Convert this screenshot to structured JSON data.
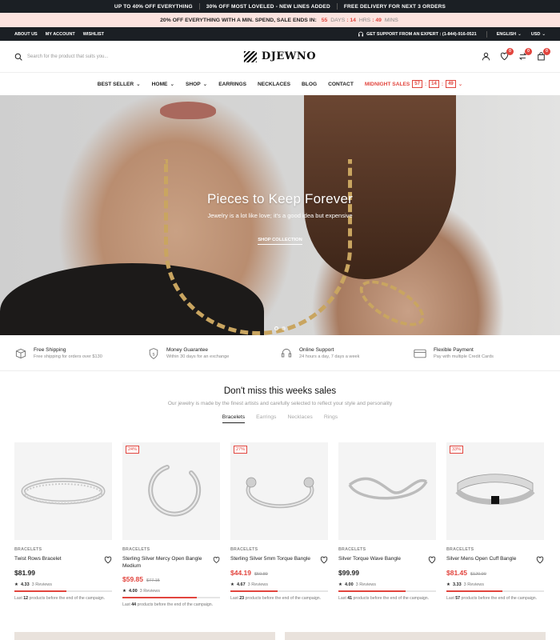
{
  "announcement": [
    "UP TO 40% OFF EVERYTHING",
    "30% OFF MOST LOVELED - NEW LINES ADDED",
    "FREE DELIVERY FOR NEXT 3 ORDERS"
  ],
  "promo": {
    "text": "20% OFF EVERYTHING WITH A MIN. SPEND, SALE ENDS IN:",
    "days": "55",
    "days_label": "DAYS",
    "hrs": "14",
    "hrs_label": "HRS",
    "mins": "49",
    "mins_label": "MINS"
  },
  "topbar": {
    "links": [
      "ABOUT US",
      "MY ACCOUNT",
      "WISHLIST"
    ],
    "support": "GET SUPPORT FROM AN EXPERT : (1-844)-916-0521",
    "language": "ENGLISH",
    "currency": "USD"
  },
  "header": {
    "search_placeholder": "Search for the product that suits you...",
    "logo": "DJEWNO",
    "wishlist_count": "0",
    "compare_count": "0",
    "cart_count": "0"
  },
  "nav": {
    "items": [
      "BEST SELLER",
      "HOME",
      "SHOP",
      "EARRINGS",
      "NECKLACES",
      "BLOG",
      "CONTACT"
    ],
    "midnight": "MIDNIGHT SALES",
    "timer": [
      "57",
      "14",
      "49"
    ]
  },
  "hero": {
    "title": "Pieces to Keep Forever",
    "subtitle": "Jewelry is a lot like love; it's a good idea but expensive",
    "cta": "SHOP COLLECTION"
  },
  "features": [
    {
      "title": "Free Shipping",
      "sub": "Free shipping for orders over $130",
      "icon": "box-icon"
    },
    {
      "title": "Money Guarantee",
      "sub": "Within 30 days for an exchange",
      "icon": "shield-icon"
    },
    {
      "title": "Online Support",
      "sub": "24 hours a day, 7 days a week",
      "icon": "headset-icon"
    },
    {
      "title": "Flexible Payment",
      "sub": "Pay with multiple Credit Cards",
      "icon": "card-icon"
    }
  ],
  "sales": {
    "title": "Don't miss this weeks sales",
    "subtitle": "Our jewelry is made by the finest artists and carefully selected to reflect your style and personality",
    "tabs": [
      "Bracelets",
      "Earrings",
      "Necklaces",
      "Rings"
    ]
  },
  "products": [
    {
      "category": "BRACELETS",
      "name": "Twist Rows Bracelet",
      "price": "$81.99",
      "old": "",
      "discount": "",
      "rating": "4.33",
      "reviews": "3 Reviews",
      "stock_pre": "Last",
      "stock": "12",
      "stock_post": "products before the end of the campaign.",
      "progress": 0.53
    },
    {
      "category": "BRACELETS",
      "name": "Sterling Silver Mercy Open Bangle Medium",
      "price": "$59.85",
      "old": "$77.15",
      "discount": "24%",
      "rating": "4.00",
      "reviews": "3 Reviews",
      "stock_pre": "Last",
      "stock": "44",
      "stock_post": "products before the end of the campaign.",
      "progress": 0.76
    },
    {
      "category": "BRACELETS",
      "name": "Sterling Silver 5mm Torque Bangle",
      "price": "$44.19",
      "old": "$59.89",
      "discount": "27%",
      "rating": "4.67",
      "reviews": "3 Reviews",
      "stock_pre": "Last",
      "stock": "23",
      "stock_post": "products before the end of the campaign.",
      "progress": 0.48
    },
    {
      "category": "BRACELETS",
      "name": "Silver Torque Wave Bangle",
      "price": "$99.99",
      "old": "",
      "discount": "",
      "rating": "4.00",
      "reviews": "3 Reviews",
      "stock_pre": "Last",
      "stock": "41",
      "stock_post": "products before the end of the campaign.",
      "progress": 0.69
    },
    {
      "category": "BRACELETS",
      "name": "Silver Mens Open Cuff Bangle",
      "price": "$81.45",
      "old": "$120.99",
      "discount": "33%",
      "rating": "3.33",
      "reviews": "3 Reviews",
      "stock_pre": "Last",
      "stock": "57",
      "stock_post": "products before the end of the campaign.",
      "progress": 0.57
    }
  ],
  "colors": {
    "accent": "#e2453e",
    "dark": "#1b1f24",
    "promo_bg": "#fbe3df"
  }
}
